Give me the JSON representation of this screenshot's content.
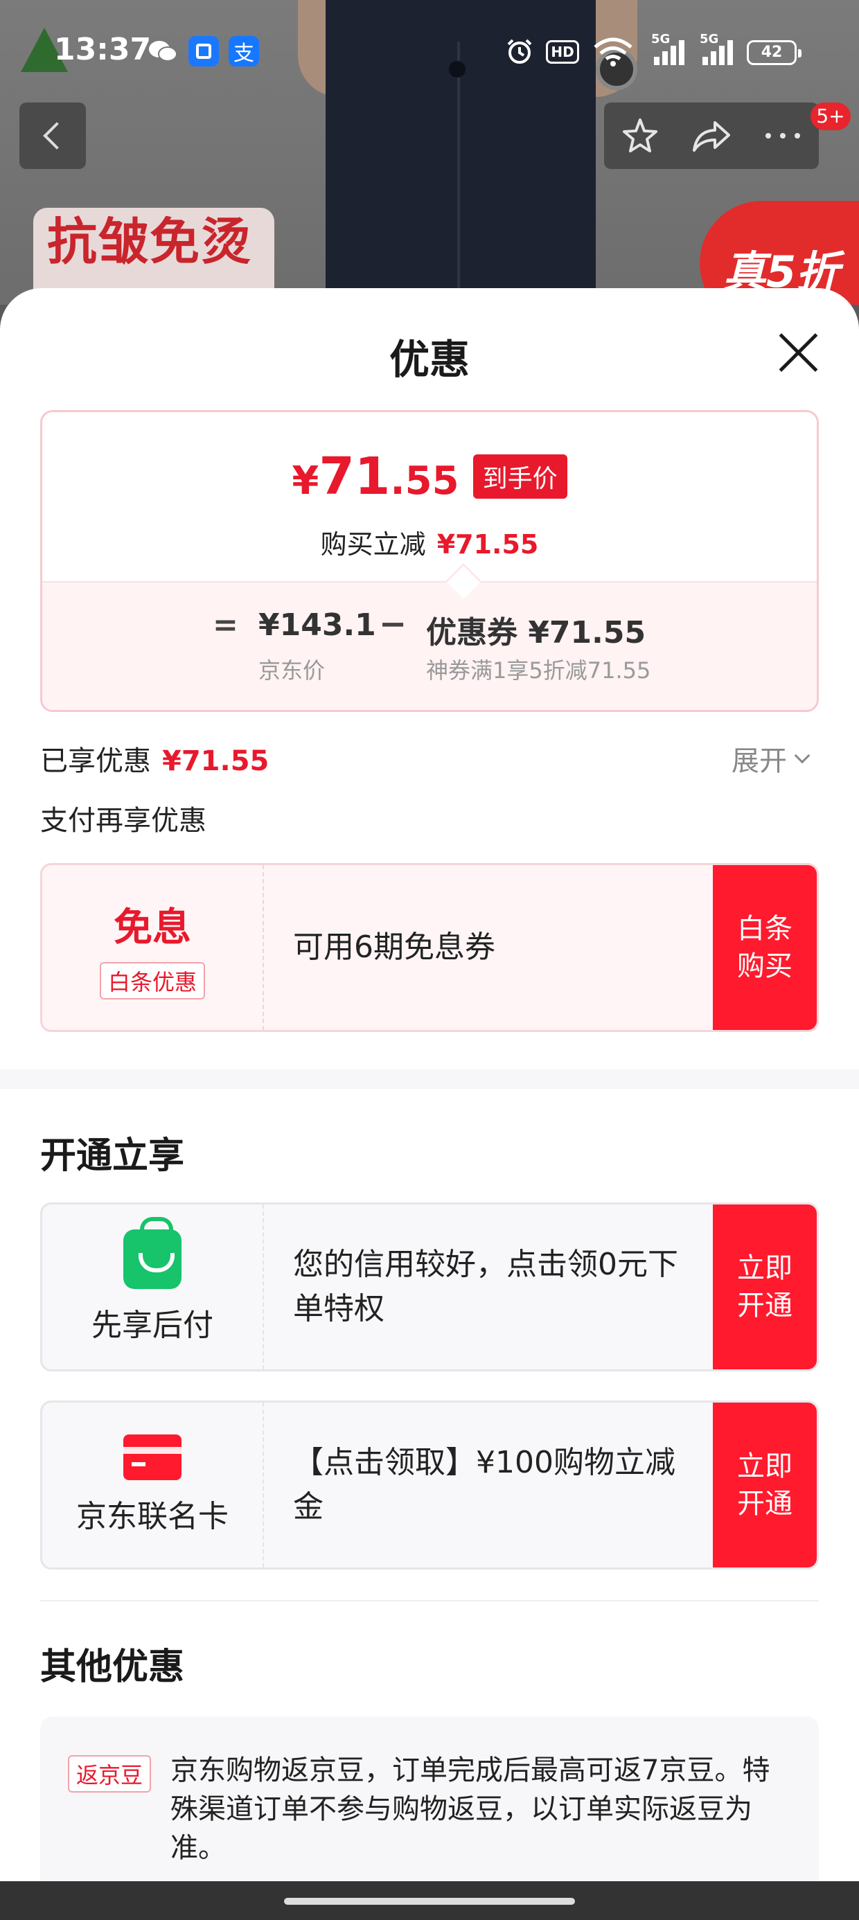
{
  "status_bar": {
    "time": "13:37",
    "battery": "42",
    "hd": "HD",
    "network": "5G"
  },
  "nav": {
    "badge": "5+"
  },
  "background": {
    "promo_left": "抗皱免烫",
    "promo_right": "真5折"
  },
  "sheet": {
    "title": "优惠"
  },
  "price_card": {
    "currency": "¥",
    "price_int": "71",
    "price_dec": ".55",
    "tag": "到手价",
    "sub_label": "购买立减",
    "sub_value": "¥71.55",
    "eq": "=",
    "jd_price": "¥143.1",
    "jd_price_label": "京东价",
    "minus": "−",
    "coupon": "优惠券 ¥71.55",
    "coupon_label": "神券满1享5折减71.55"
  },
  "enjoyed": {
    "label": "已享优惠",
    "value": "¥71.55",
    "expand": "展开"
  },
  "pay_more": "支付再享优惠",
  "offer_baitiao": {
    "title": "免息",
    "tag": "白条优惠",
    "text": "可用6期免息券",
    "button": "白条\n购买"
  },
  "open_section": {
    "title": "开通立享",
    "pay_later": {
      "label": "先享后付",
      "text": "您的信用较好，点击领0元下单特权",
      "button": "立即\n开通"
    },
    "jd_card": {
      "label": "京东联名卡",
      "text": "【点击领取】¥100购物立减金",
      "button": "立即\n开通"
    }
  },
  "other_section": {
    "title": "其他优惠",
    "tag": "返京豆",
    "text": "京东购物返京豆，订单完成后最高可返7京豆。特殊渠道订单不参与购物返豆，以订单实际返豆为准。"
  }
}
